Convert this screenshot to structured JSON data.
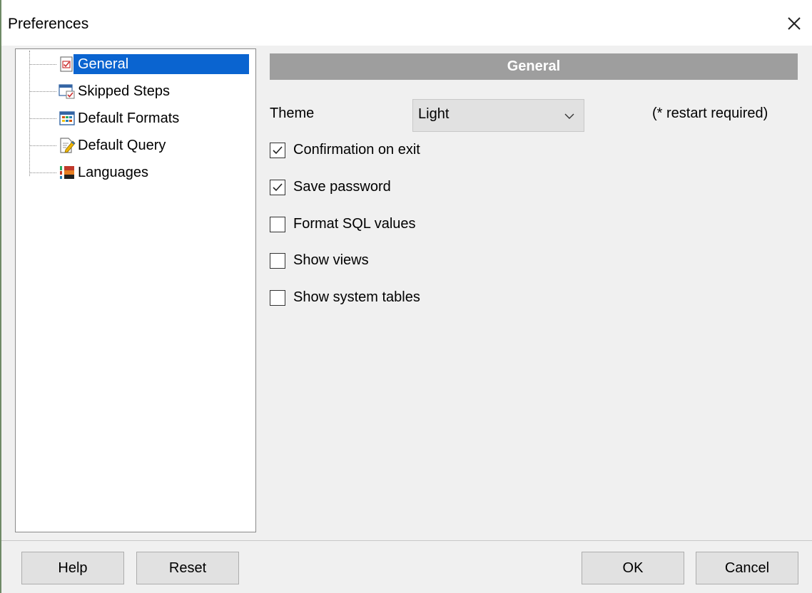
{
  "window": {
    "title": "Preferences"
  },
  "tree": {
    "items": [
      {
        "label": "General",
        "icon": "general-checklist-icon",
        "selected": true
      },
      {
        "label": "Skipped Steps",
        "icon": "skipped-steps-icon",
        "selected": false
      },
      {
        "label": "Default Formats",
        "icon": "table-grid-icon",
        "selected": false
      },
      {
        "label": "Default Query",
        "icon": "edit-document-icon",
        "selected": false
      },
      {
        "label": "Languages",
        "icon": "languages-flag-icon",
        "selected": false
      }
    ]
  },
  "panel": {
    "header": "General",
    "theme_label": "Theme",
    "theme_value": "Light",
    "restart_note": "(* restart required)",
    "checkboxes": [
      {
        "label": "Confirmation on exit",
        "checked": true
      },
      {
        "label": "Save password",
        "checked": true
      },
      {
        "label": "Format SQL values",
        "checked": false
      },
      {
        "label": "Show views",
        "checked": false
      },
      {
        "label": "Show system tables",
        "checked": false
      }
    ]
  },
  "buttons": {
    "help": "Help",
    "reset": "Reset",
    "ok": "OK",
    "cancel": "Cancel"
  },
  "colors": {
    "selection": "#0a64d0",
    "header_bar": "#9e9e9e",
    "window_bg": "#f0f0f0"
  }
}
